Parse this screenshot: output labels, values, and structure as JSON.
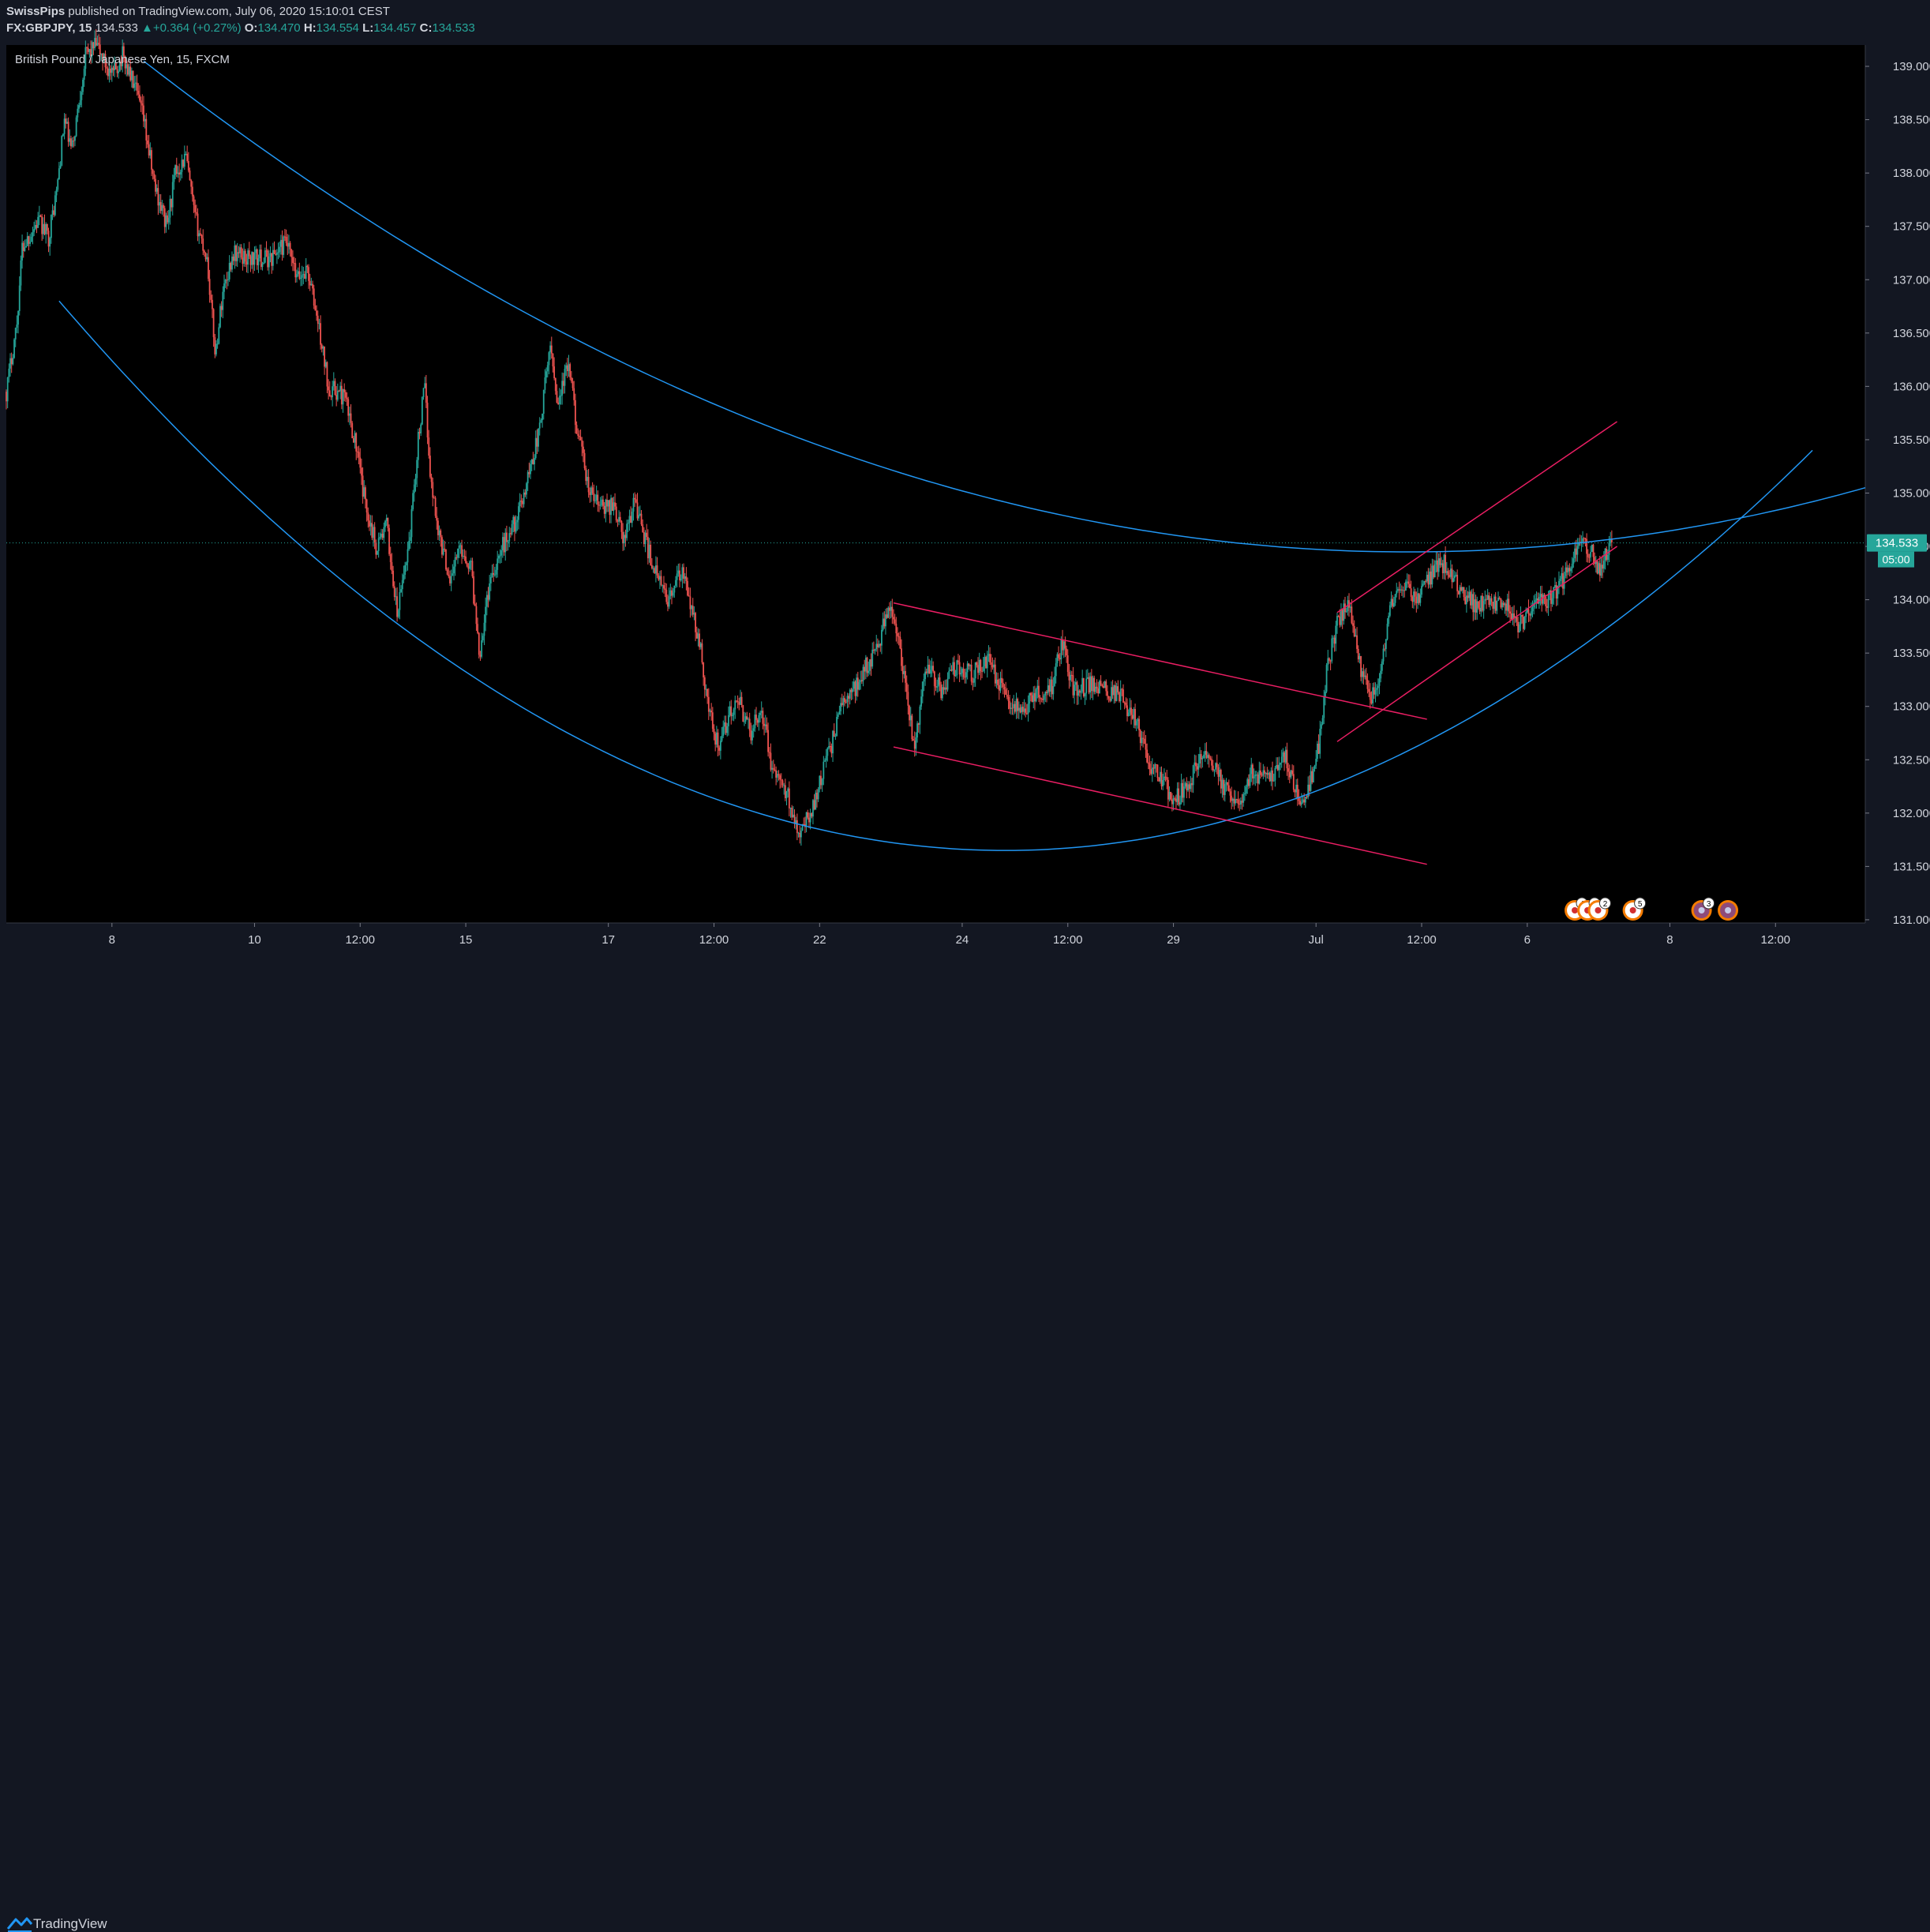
{
  "header": {
    "publisher": "SwissPips",
    "published_text": "published on TradingView.com, July 06, 2020 15:10:01 CEST",
    "symbol": "FX:GBPJPY, 15",
    "last": "134.533",
    "change_arrow": "▲",
    "change": "+0.364 (+0.27%)",
    "o_label": "O:",
    "o_value": "134.470",
    "h_label": "H:",
    "h_value": "134.554",
    "l_label": "L:",
    "l_value": "134.457",
    "c_label": "C:",
    "c_value": "134.533"
  },
  "chart_title": "British Pound / Japanese Yen, 15, FXCM",
  "footer": {
    "brand": "TradingView",
    "logo_icon": "tradingview-logo-icon"
  },
  "colors": {
    "background": "#000000",
    "panel": "#131722",
    "text": "#d1d4dc",
    "up": "#26a69a",
    "down": "#ef5350",
    "arc_lines": "#2196f3",
    "channel_lines": "#e91e63",
    "last_price_tag": "#26a69a"
  },
  "chart_data": {
    "type": "candlestick",
    "ylim": [
      130.97,
      139.2
    ],
    "xlim": [
      0,
      17.6
    ],
    "y_ticks": [
      139.0,
      138.5,
      138.0,
      137.5,
      137.0,
      136.5,
      136.0,
      135.5,
      135.0,
      134.5,
      134.0,
      133.5,
      133.0,
      132.5,
      132.0,
      131.5,
      131.0
    ],
    "y_tick_labels": [
      "139.000",
      "138.500",
      "138.000",
      "137.500",
      "137.000",
      "136.500",
      "136.000",
      "135.500",
      "135.000",
      "134.500",
      "134.000",
      "133.500",
      "133.000",
      "132.500",
      "132.000",
      "131.500",
      "131.000"
    ],
    "x_ticks": [
      {
        "label": "8",
        "t": 1.0
      },
      {
        "label": "10",
        "t": 2.35
      },
      {
        "label": "12:00",
        "t": 3.35
      },
      {
        "label": "15",
        "t": 4.35
      },
      {
        "label": "17",
        "t": 5.7
      },
      {
        "label": "12:00",
        "t": 6.7
      },
      {
        "label": "22",
        "t": 7.7
      },
      {
        "label": "24",
        "t": 9.05
      },
      {
        "label": "12:00",
        "t": 10.05
      },
      {
        "label": "29",
        "t": 11.05
      },
      {
        "label": "Jul",
        "t": 12.4
      },
      {
        "label": "12:00",
        "t": 13.4
      },
      {
        "label": "6",
        "t": 14.4
      },
      {
        "label": "8",
        "t": 15.75
      },
      {
        "label": "12:00",
        "t": 16.75
      }
    ],
    "price_path": [
      [
        0.0,
        135.95
      ],
      [
        0.1,
        136.6
      ],
      [
        0.15,
        137.3
      ],
      [
        0.3,
        137.55
      ],
      [
        0.4,
        137.4
      ],
      [
        0.48,
        137.85
      ],
      [
        0.55,
        138.5
      ],
      [
        0.62,
        138.2
      ],
      [
        0.75,
        139.1
      ],
      [
        0.85,
        139.2
      ],
      [
        1.0,
        138.9
      ],
      [
        1.1,
        139.1
      ],
      [
        1.2,
        138.85
      ],
      [
        1.3,
        138.5
      ],
      [
        1.4,
        137.9
      ],
      [
        1.52,
        137.5
      ],
      [
        1.6,
        138.0
      ],
      [
        1.7,
        138.15
      ],
      [
        1.78,
        137.6
      ],
      [
        1.9,
        137.2
      ],
      [
        1.98,
        136.3
      ],
      [
        2.05,
        136.9
      ],
      [
        2.15,
        137.25
      ],
      [
        2.3,
        137.2
      ],
      [
        2.5,
        137.2
      ],
      [
        2.65,
        137.35
      ],
      [
        2.75,
        137.0
      ],
      [
        2.85,
        137.1
      ],
      [
        2.95,
        136.6
      ],
      [
        3.05,
        136.0
      ],
      [
        3.2,
        135.9
      ],
      [
        3.3,
        135.5
      ],
      [
        3.38,
        135.0
      ],
      [
        3.5,
        134.5
      ],
      [
        3.6,
        134.7
      ],
      [
        3.7,
        133.85
      ],
      [
        3.82,
        134.6
      ],
      [
        3.9,
        135.5
      ],
      [
        3.96,
        136.0
      ],
      [
        4.02,
        135.1
      ],
      [
        4.1,
        134.6
      ],
      [
        4.2,
        134.2
      ],
      [
        4.3,
        134.5
      ],
      [
        4.4,
        134.3
      ],
      [
        4.48,
        133.5
      ],
      [
        4.58,
        134.2
      ],
      [
        4.7,
        134.5
      ],
      [
        4.85,
        134.8
      ],
      [
        4.95,
        135.2
      ],
      [
        5.05,
        135.6
      ],
      [
        5.15,
        136.4
      ],
      [
        5.22,
        135.85
      ],
      [
        5.32,
        136.2
      ],
      [
        5.42,
        135.5
      ],
      [
        5.52,
        135.0
      ],
      [
        5.65,
        134.85
      ],
      [
        5.75,
        134.9
      ],
      [
        5.85,
        134.55
      ],
      [
        5.95,
        134.95
      ],
      [
        6.05,
        134.55
      ],
      [
        6.15,
        134.25
      ],
      [
        6.25,
        134.0
      ],
      [
        6.4,
        134.25
      ],
      [
        6.5,
        133.85
      ],
      [
        6.58,
        133.5
      ],
      [
        6.65,
        132.95
      ],
      [
        6.75,
        132.6
      ],
      [
        6.85,
        132.95
      ],
      [
        6.95,
        133.0
      ],
      [
        7.05,
        132.75
      ],
      [
        7.15,
        133.0
      ],
      [
        7.25,
        132.4
      ],
      [
        7.4,
        132.15
      ],
      [
        7.5,
        131.85
      ],
      [
        7.6,
        131.95
      ],
      [
        7.7,
        132.3
      ],
      [
        7.8,
        132.6
      ],
      [
        7.9,
        133.0
      ],
      [
        8.05,
        133.2
      ],
      [
        8.15,
        133.4
      ],
      [
        8.25,
        133.55
      ],
      [
        8.35,
        133.95
      ],
      [
        8.45,
        133.6
      ],
      [
        8.52,
        133.1
      ],
      [
        8.6,
        132.6
      ],
      [
        8.7,
        133.4
      ],
      [
        8.85,
        133.15
      ],
      [
        9.0,
        133.4
      ],
      [
        9.15,
        133.3
      ],
      [
        9.3,
        133.45
      ],
      [
        9.45,
        133.1
      ],
      [
        9.6,
        132.95
      ],
      [
        9.75,
        133.1
      ],
      [
        9.9,
        133.2
      ],
      [
        10.0,
        133.6
      ],
      [
        10.1,
        133.15
      ],
      [
        10.25,
        133.2
      ],
      [
        10.4,
        133.15
      ],
      [
        10.55,
        133.1
      ],
      [
        10.7,
        132.85
      ],
      [
        10.8,
        132.5
      ],
      [
        10.95,
        132.3
      ],
      [
        11.05,
        132.1
      ],
      [
        11.2,
        132.3
      ],
      [
        11.35,
        132.6
      ],
      [
        11.5,
        132.3
      ],
      [
        11.65,
        132.05
      ],
      [
        11.8,
        132.4
      ],
      [
        11.95,
        132.3
      ],
      [
        12.1,
        132.55
      ],
      [
        12.2,
        132.2
      ],
      [
        12.3,
        132.1
      ],
      [
        12.42,
        132.6
      ],
      [
        12.5,
        133.3
      ],
      [
        12.6,
        133.8
      ],
      [
        12.72,
        133.95
      ],
      [
        12.82,
        133.35
      ],
      [
        12.92,
        133.05
      ],
      [
        13.02,
        133.35
      ],
      [
        13.1,
        133.9
      ],
      [
        13.2,
        134.15
      ],
      [
        13.35,
        134.0
      ],
      [
        13.5,
        134.25
      ],
      [
        13.62,
        134.35
      ],
      [
        13.75,
        134.1
      ],
      [
        13.9,
        133.95
      ],
      [
        14.05,
        134.0
      ],
      [
        14.2,
        133.95
      ],
      [
        14.32,
        133.75
      ],
      [
        14.45,
        133.95
      ],
      [
        14.6,
        134.0
      ],
      [
        14.75,
        134.2
      ],
      [
        14.9,
        134.55
      ],
      [
        15.0,
        134.45
      ],
      [
        15.08,
        134.3
      ],
      [
        15.2,
        134.533
      ]
    ],
    "last_price": 134.533,
    "last_price_label": "134.533",
    "countdown_label": "05:00"
  },
  "drawings": {
    "upper_arc": {
      "color": "#2196f3",
      "points": [
        [
          1.3,
          139.05
        ],
        [
          12.0,
          134.5
        ],
        [
          17.6,
          135.05
        ]
      ]
    },
    "lower_arc": {
      "color": "#2196f3",
      "points": [
        [
          0.5,
          136.8
        ],
        [
          9.4,
          131.65
        ],
        [
          17.1,
          135.4
        ]
      ]
    },
    "desc_channel_top": {
      "color": "#e91e63",
      "from": [
        8.4,
        133.97
      ],
      "to": [
        13.45,
        132.88
      ]
    },
    "desc_channel_bottom": {
      "color": "#e91e63",
      "from": [
        8.4,
        132.62
      ],
      "to": [
        13.45,
        131.52
      ]
    },
    "asc_channel_top": {
      "color": "#e91e63",
      "from": [
        12.6,
        133.88
      ],
      "to": [
        15.25,
        135.67
      ]
    },
    "asc_channel_bottom": {
      "color": "#e91e63",
      "from": [
        12.6,
        132.67
      ],
      "to": [
        15.25,
        134.5
      ]
    }
  },
  "events": [
    {
      "t": 14.85,
      "count": "4",
      "icon": "event-flag-icon"
    },
    {
      "t": 14.97,
      "count": "2",
      "icon": "event-flag-icon"
    },
    {
      "t": 15.07,
      "count": "2",
      "icon": "event-flag-icon"
    },
    {
      "t": 15.4,
      "count": "5",
      "icon": "event-flag-icon"
    },
    {
      "t": 16.05,
      "count": "3",
      "icon": "uk-flag-icon"
    },
    {
      "t": 16.3,
      "count": "",
      "icon": "uk-flag-icon"
    }
  ]
}
